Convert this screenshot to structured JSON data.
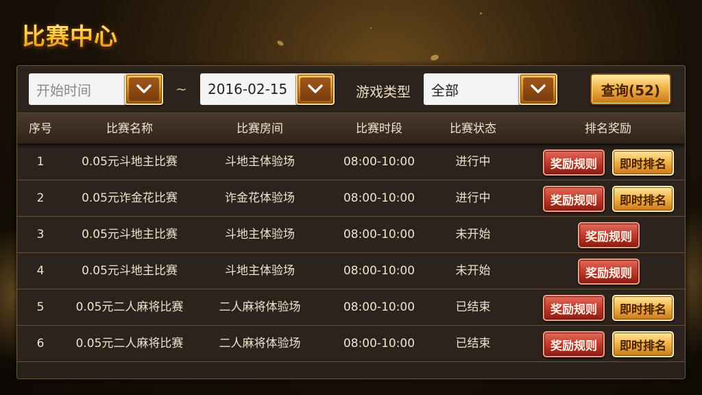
{
  "page": {
    "title": "比赛中心"
  },
  "filters": {
    "start_time_placeholder": "开始时间",
    "range_separator": "~",
    "end_date_value": "2016-02-15",
    "game_type_label": "游戏类型",
    "game_type_value": "全部",
    "query_label": "查询(52)"
  },
  "table": {
    "headers": [
      "序号",
      "比赛名称",
      "比赛房间",
      "比赛时段",
      "比赛状态",
      "排名奖励"
    ],
    "rows": [
      {
        "no": "1",
        "name": "0.05元斗地主比赛",
        "room": "斗地主体验场",
        "time": "08:00-10:00",
        "status": "进行中",
        "rules": "奖励规则",
        "ranking": "即时排名"
      },
      {
        "no": "2",
        "name": "0.05元诈金花比赛",
        "room": "诈金花体验场",
        "time": "08:00-10:00",
        "status": "进行中",
        "rules": "奖励规则",
        "ranking": "即时排名"
      },
      {
        "no": "3",
        "name": "0.05元斗地主比赛",
        "room": "斗地主体验场",
        "time": "08:00-10:00",
        "status": "未开始",
        "rules": "奖励规则",
        "ranking": null
      },
      {
        "no": "4",
        "name": "0.05元斗地主比赛",
        "room": "斗地主体验场",
        "time": "08:00-10:00",
        "status": "未开始",
        "rules": "奖励规则",
        "ranking": null
      },
      {
        "no": "5",
        "name": "0.05元二人麻将比赛",
        "room": "二人麻将体验场",
        "time": "08:00-10:00",
        "status": "已结束",
        "rules": "奖励规则",
        "ranking": "即时排名"
      },
      {
        "no": "6",
        "name": "0.05元二人麻将比赛",
        "room": "二人麻将体验场",
        "time": "08:00-10:00",
        "status": "已结束",
        "rules": "奖励规则",
        "ranking": "即时排名"
      }
    ]
  },
  "icons": {
    "dropdown": "chevron-down-icon"
  },
  "colors": {
    "gold": "#f2b74a",
    "red_button": "#c0392b",
    "panel": "#2c231d"
  }
}
